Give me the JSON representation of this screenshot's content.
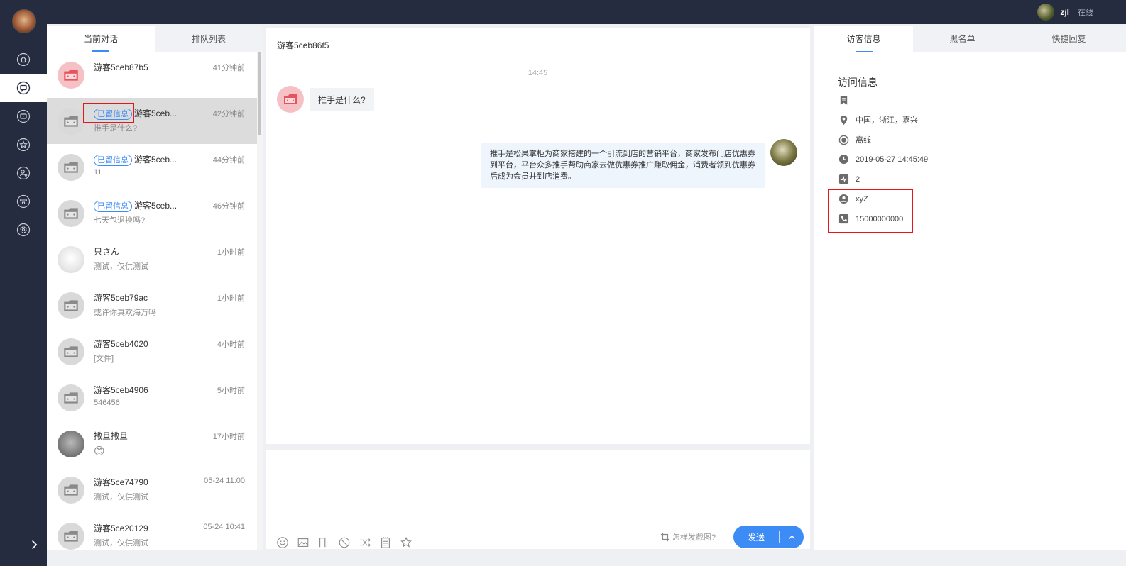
{
  "topbar": {
    "user_name": "zjl",
    "status": "在线"
  },
  "rail": {
    "icons": [
      "home-icon",
      "chat-icon",
      "history-icon",
      "star-icon",
      "user-settings-icon",
      "store-icon",
      "settings-icon"
    ],
    "active_index": 1
  },
  "conversations": {
    "tabs": [
      {
        "label": "当前对话",
        "active": true
      },
      {
        "label": "排队列表",
        "active": false
      }
    ],
    "items": [
      {
        "name": "游客5ceb87b5",
        "badge": "",
        "time": "41分钟前",
        "preview": "",
        "avatar": "red"
      },
      {
        "name": "游客5ceb...",
        "badge": "已留信息",
        "time": "42分钟前",
        "preview": "推手是什么?",
        "avatar": "gray",
        "selected": true
      },
      {
        "name": "游客5ceb...",
        "badge": "已留信息",
        "time": "44分钟前",
        "preview": "11",
        "avatar": "gray"
      },
      {
        "name": "游客5ceb...",
        "badge": "已留信息",
        "time": "46分钟前",
        "preview": "七天包退换吗?",
        "avatar": "gray"
      },
      {
        "name": "只さん",
        "badge": "",
        "time": "1小时前",
        "preview": "测试，仅供测试",
        "avatar": "photo1"
      },
      {
        "name": "游客5ceb79ac",
        "badge": "",
        "time": "1小时前",
        "preview": "或许你真欢海万吗",
        "avatar": "gray"
      },
      {
        "name": "游客5ceb4020",
        "badge": "",
        "time": "4小时前",
        "preview": "[文件]",
        "avatar": "gray"
      },
      {
        "name": "游客5ceb4906",
        "badge": "",
        "time": "5小时前",
        "preview": "546456",
        "avatar": "gray"
      },
      {
        "name": "撒旦撒旦",
        "badge": "",
        "time": "17小时前",
        "preview": "😊",
        "avatar": "photo2"
      },
      {
        "name": "游客5ce74790",
        "badge": "",
        "time": "05-24 11:00",
        "preview": "测试，仅供测试",
        "avatar": "gray"
      },
      {
        "name": "游客5ce20129",
        "badge": "",
        "time": "05-24 10:41",
        "preview": "测试，仅供测试",
        "avatar": "gray"
      }
    ]
  },
  "chat": {
    "title": "游客5ceb86f5",
    "time_divider": "14:45",
    "visitor_message": "推手是什么?",
    "agent_message": "推手是松果掌柜为商家搭建的一个引流到店的营销平台，商家发布门店优惠券到平台，平台众多推手帮助商家去做优惠券推广赚取佣金，消费者领到优惠券后成为会员并到店消费。"
  },
  "input": {
    "tools": [
      "emoji-icon",
      "image-icon",
      "file-icon",
      "block-icon",
      "transfer-icon",
      "note-icon",
      "star-icon"
    ],
    "screenshot_tip": "怎样发截图?",
    "send_label": "发送"
  },
  "info": {
    "tabs": [
      {
        "label": "访客信息",
        "active": true
      },
      {
        "label": "黑名单",
        "active": false
      },
      {
        "label": "快捷回复",
        "active": false
      }
    ],
    "title": "访问信息",
    "location": "中国，浙江，嘉兴",
    "status": "离线",
    "datetime": "2019-05-27 14:45:49",
    "visits": "2",
    "name": "xyZ",
    "phone": "15000000000"
  },
  "colors": {
    "accent": "#3d8bf5",
    "sidebar": "#252c3f",
    "highlight": "#e8161c"
  }
}
